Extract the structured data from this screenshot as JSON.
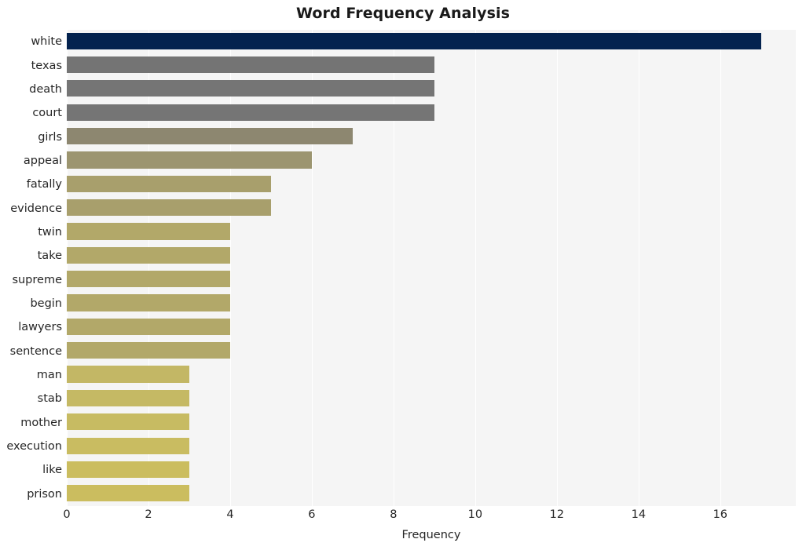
{
  "chart_data": {
    "type": "bar",
    "orientation": "horizontal",
    "title": "Word Frequency Analysis",
    "xlabel": "Frequency",
    "ylabel": "",
    "xlim": [
      0,
      17.85
    ],
    "ylim": [
      0,
      20
    ],
    "grid": true,
    "legend": null,
    "xticks": [
      "0",
      "2",
      "4",
      "6",
      "8",
      "10",
      "12",
      "14",
      "16"
    ],
    "xtick_values": [
      0,
      2,
      4,
      6,
      8,
      10,
      12,
      14,
      16
    ],
    "categories": [
      "white",
      "texas",
      "death",
      "court",
      "girls",
      "appeal",
      "fatally",
      "evidence",
      "twin",
      "take",
      "supreme",
      "begin",
      "lawyers",
      "sentence",
      "man",
      "stab",
      "mother",
      "execution",
      "like",
      "prison"
    ],
    "values": [
      17,
      9,
      9,
      9,
      7,
      6,
      5,
      5,
      4,
      4,
      4,
      4,
      4,
      4,
      3,
      3,
      3,
      3,
      3,
      3
    ],
    "bar_colors": [
      "#04234f",
      "#747474",
      "#757575",
      "#757575",
      "#8d8770",
      "#9c9570",
      "#a89f6c",
      "#a89f6c",
      "#b2a869",
      "#b2a869",
      "#b2a869",
      "#b2a869",
      "#b2a869",
      "#b2a869",
      "#c3b765",
      "#c5b964",
      "#c7bb62",
      "#c9bc61",
      "#cbbd5f",
      "#cbbd5f"
    ],
    "plot_background": "#f5f5f5",
    "figure_background": "#ffffff",
    "gridline_color": "#ffffff",
    "text_color": "#262626",
    "title_color": "#1a1a1a"
  }
}
